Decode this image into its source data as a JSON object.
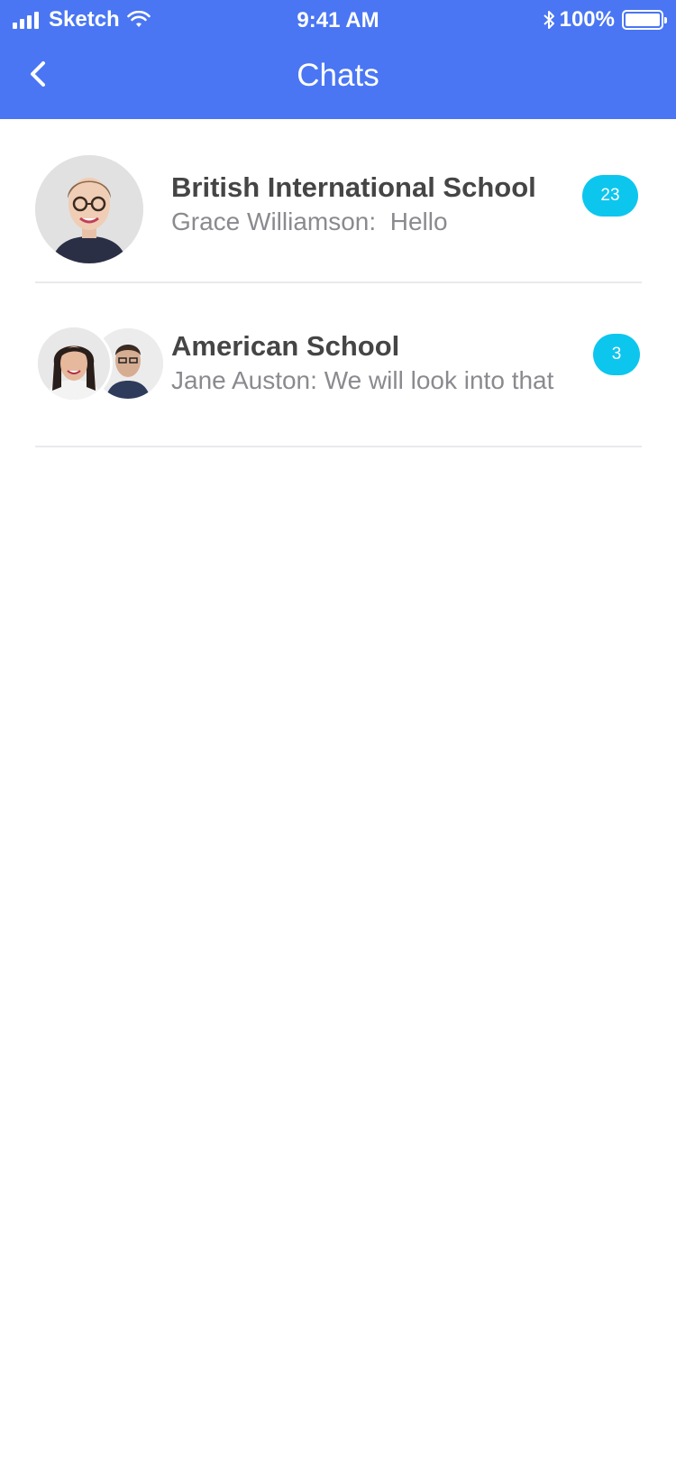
{
  "status_bar": {
    "carrier": "Sketch",
    "time": "9:41 AM",
    "battery": "100%",
    "icons": [
      "signal-icon",
      "wifi-icon",
      "bluetooth-icon",
      "battery-icon"
    ]
  },
  "nav": {
    "title": "Chats",
    "back_icon": "chevron-left-icon"
  },
  "colors": {
    "header_bg": "#4a76f3",
    "badge_bg": "#0dc6ee",
    "title_text": "#454545",
    "subtitle_text": "#8a8a8f"
  },
  "chats": [
    {
      "title": "British International School",
      "sender": "Grace Williamson:",
      "message": "Hello",
      "unread": "23",
      "avatar": "single-avatar"
    },
    {
      "title": "American School",
      "sender": "Jane Auston:",
      "message": "We will look into that",
      "unread": "3",
      "avatar": "group-avatar"
    }
  ]
}
